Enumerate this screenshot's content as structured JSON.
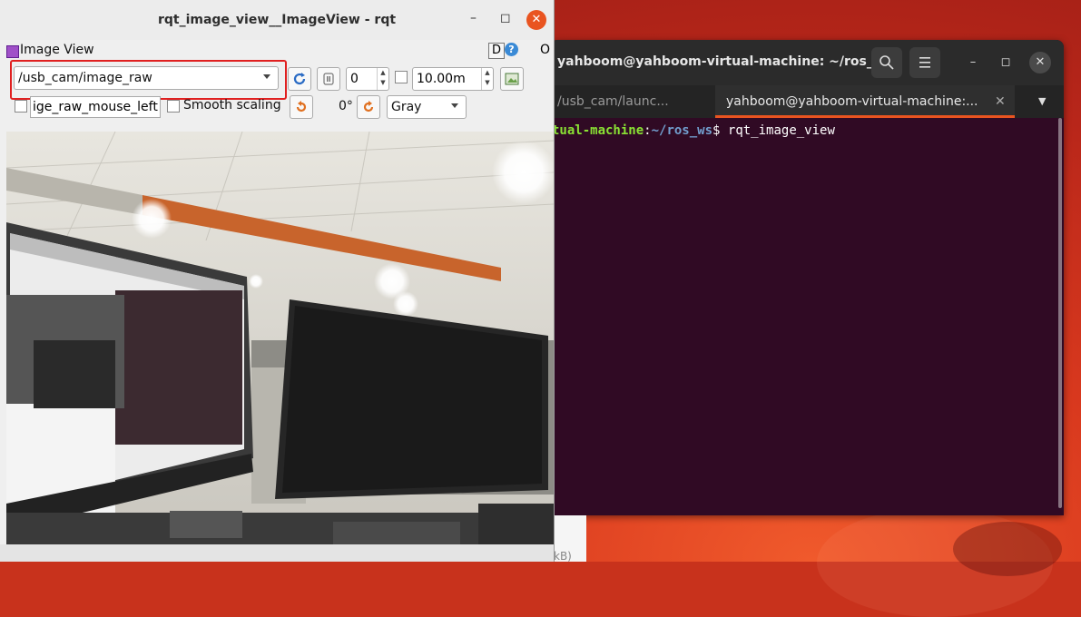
{
  "terminal": {
    "title": "yahboom@yahboom-virtual-machine: ~/ros_ws",
    "tabs": [
      {
        "label": "/usb_cam/launc..."
      },
      {
        "label": "yahboom@yahboom-virtual-machine:..."
      }
    ],
    "prompt_host": "tual-machine",
    "prompt_path": "~/ros_ws",
    "command": "$ rqt_image_view",
    "search_icon": "search-icon",
    "menu_icon": "hamburger-menu-icon"
  },
  "under_window": {
    "text": "kB)"
  },
  "rqt": {
    "title": "rqt_image_view__ImageView - rqt",
    "plugin_label": "Image View",
    "d_label": "D",
    "help_label": "?",
    "o_label": "O",
    "topic": "/usb_cam/image_raw",
    "fps_value": "0",
    "max_range": "10.00m",
    "mouse_topic": "ige_raw_mouse_left",
    "smooth_label": "Smooth scaling",
    "rotation": "0°",
    "color_scheme": "Gray"
  },
  "colors": {
    "highlight": "#e02020",
    "terminal_bg": "#300a24",
    "close_button": "#e95420",
    "prompt_green": "#8ae234",
    "prompt_blue": "#729fcf"
  }
}
